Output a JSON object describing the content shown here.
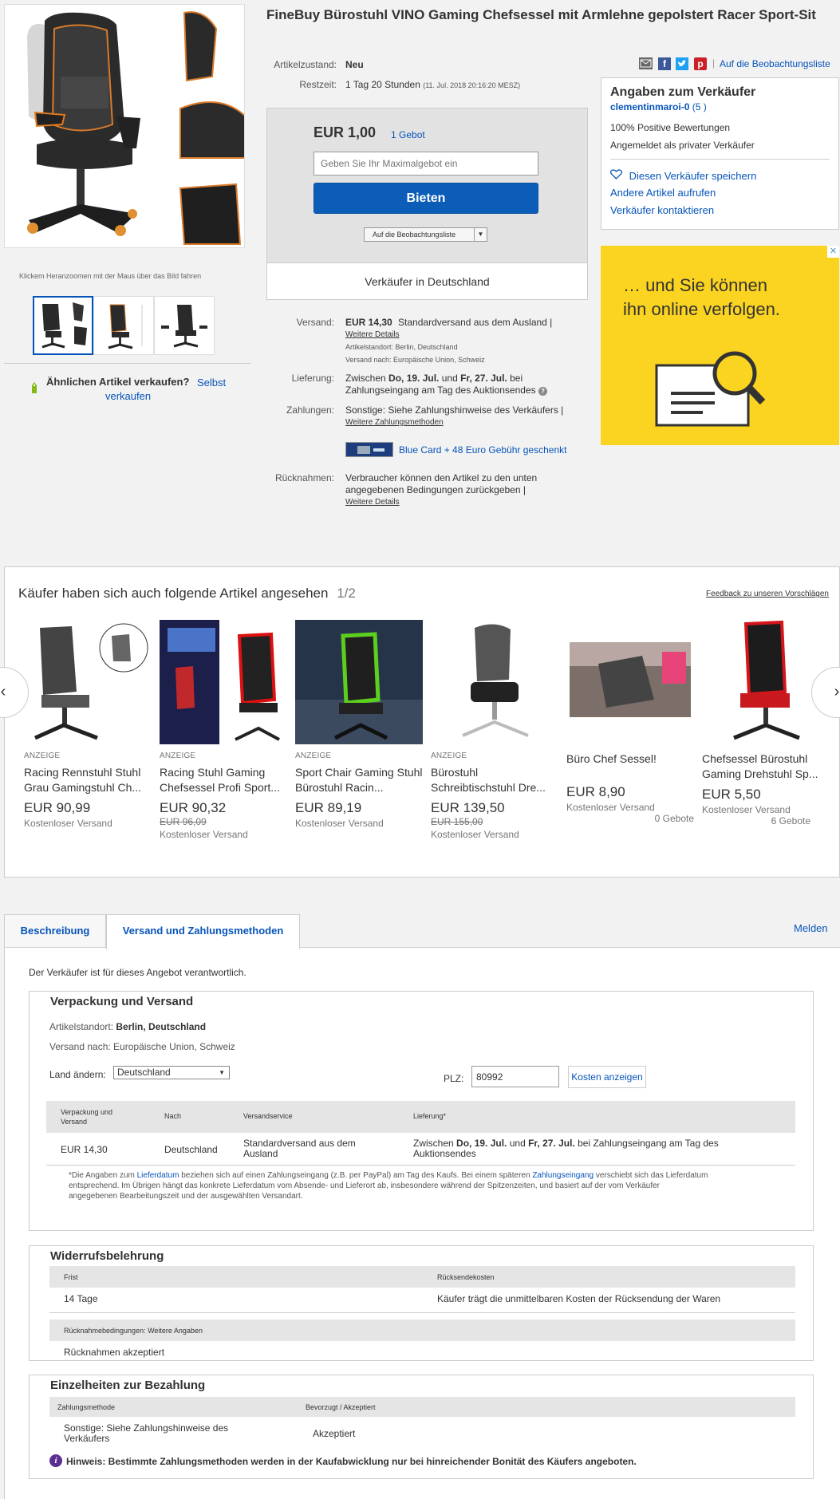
{
  "item": {
    "title": "FineBuy Bürostuhl VINO Gaming Chefsessel mit Armlehne gepolstert Racer Sport-Sit",
    "condition_label": "Artikelzustand:",
    "condition_value": "Neu",
    "time_label": "Restzeit:",
    "time_value": "1 Tag 20 Stunden",
    "time_detail": "(11. Jul. 2018  20:16:20 MESZ)"
  },
  "share": {
    "watch_link": "Auf die Beobachtungsliste"
  },
  "gallery": {
    "zoom_hint": "Klickem Heranzoomen mit der Maus über das Bild fahren"
  },
  "sell_similar": {
    "label": "Ähnlichen Artikel verkaufen?",
    "link": "Selbst verkaufen"
  },
  "buybox": {
    "price": "EUR 1,00",
    "bids": "1 Gebot",
    "placeholder": "Geben Sie Ihr Maximalgebot ein",
    "bid_button": "Bieten",
    "watchlist": "Auf die Beobachtungsliste",
    "seller_location": "Verkäufer in Deutschland"
  },
  "seller": {
    "title": "Angaben zum Verkäufer",
    "name": "clementinmaroi-0",
    "score": "(5 )",
    "positive": "100% Positive Bewertungen",
    "type": "Angemeldet als privater Verkäufer",
    "save": "Diesen Verkäufer speichern",
    "other_items": "Andere Artikel aufrufen",
    "contact": "Verkäufer kontaktieren"
  },
  "ad": {
    "line1": "… und Sie können",
    "line2": "ihn online verfolgen.",
    "close": "✕"
  },
  "shipping": {
    "label": "Versand:",
    "price": "EUR 14,30",
    "service": "Standardversand aus dem Ausland |",
    "details_link": "Weitere Details",
    "location": "Artikelstandort:  Berlin, Deutschland",
    "ship_to": "Versand nach:  Europäische Union, Schweiz"
  },
  "delivery": {
    "label": "Lieferung:",
    "line1_pre": "Zwischen ",
    "d1": "Do, 19. Jul.",
    "mid": " und ",
    "d2": "Fr, 27. Jul.",
    "line1_post": " bei",
    "line2": "Zahlungseingang am Tag des Auktionsendes"
  },
  "payment": {
    "label": "Zahlungen:",
    "text": "Sonstige: Siehe Zahlungshinweise des Verkäufers  |",
    "link": "Weitere Zahlungsmethoden",
    "bluecard": "Blue Card + 48 Euro Gebühr geschenkt"
  },
  "returns": {
    "label": "Rücknahmen:",
    "line1": "Verbraucher können den Artikel zu den unten",
    "line2": "angegebenen Bedingungen zurückgeben |",
    "link": "Weitere Details"
  },
  "carousel": {
    "title": "Käufer haben sich auch folgende Artikel angesehen",
    "page": "1/2",
    "feedback": "Feedback zu unseren Vorschlägen",
    "items": [
      {
        "tag": "ANZEIGE",
        "title": "Racing Rennstuhl Stuhl Grau Gamingstuhl Ch...",
        "price": "EUR 90,99",
        "old": "",
        "ship": "Kostenloser Versand",
        "bids": ""
      },
      {
        "tag": "ANZEIGE",
        "title": "Racing Stuhl Gaming Chefsessel Profi Sport...",
        "price": "EUR 90,32",
        "old": "EUR 96,09",
        "ship": "Kostenloser Versand",
        "bids": ""
      },
      {
        "tag": "ANZEIGE",
        "title": "Sport Chair Gaming Stuhl Bürostuhl Racin...",
        "price": "EUR 89,19",
        "old": "",
        "ship": "Kostenloser Versand",
        "bids": ""
      },
      {
        "tag": "ANZEIGE",
        "title": "Bürostuhl Schreibtischstuhl Dre...",
        "price": "EUR 139,50",
        "old": "EUR 155,00",
        "ship": "Kostenloser Versand",
        "bids": ""
      },
      {
        "tag": "",
        "title": "Büro Chef Sessel!",
        "price": "EUR 8,90",
        "old": "",
        "ship": "Kostenloser Versand",
        "bids": "0 Gebote"
      },
      {
        "tag": "",
        "title": "Chefsessel Bürostuhl Gaming Drehstuhl Sp...",
        "price": "EUR 5,50",
        "old": "",
        "ship": "Kostenloser Versand",
        "bids": "6 Gebote"
      }
    ]
  },
  "tabs": {
    "desc": "Beschreibung",
    "ship": "Versand und Zahlungsmethoden",
    "report": "Melden"
  },
  "details": {
    "responsible": "Der Verkäufer ist für dieses Angebot verantwortlich.",
    "pack_title": "Verpackung und Versand",
    "loc_label": "Artikelstandort: ",
    "loc_value": "Berlin, Deutschland",
    "shipto": "Versand nach: Europäische Union, Schweiz",
    "country_label": "Land ändern:",
    "country": "Deutschland",
    "zip_label": "PLZ:",
    "zip": "80992",
    "cost_btn": "Kosten anzeigen",
    "th_pack": "Verpackung und",
    "th_pack2": "Versand",
    "th_to": "Nach",
    "th_service": "Versandservice",
    "th_delivery": "Lieferung*",
    "r_price": "EUR 14,30",
    "r_to": "Deutschland",
    "r_service1": "Standardversand aus dem",
    "r_service2": "Ausland",
    "r_del_pre": "Zwischen ",
    "r_d1": "Do, 19. Jul.",
    "r_mid": " und ",
    "r_d2": "Fr, 27. Jul.",
    "r_del_post": " bei Zahlungseingang am Tag des",
    "r_del2": "Auktionsendes",
    "note_a": "*Die Angaben zum ",
    "note_l1": "Lieferdatum",
    "note_b": " beziehen sich auf einen Zahlungseingang (z.B. per PayPal) am Tag des Kaufs. Bei einem späteren ",
    "note_l2": "Zahlungseingang",
    "note_c": " verschiebt sich das Lieferdatum",
    "note_2": "entsprechend. Im Übrigen hängt das konkrete Lieferdatum vom Absende- und Lieferort ab, insbesondere während der Spitzenzeiten, und basiert auf der vom Verkäufer",
    "note_3": "angegebenen Bearbeitungszeit und der ausgewählten Versandart.",
    "wr_title": "Widerrufsbelehrung",
    "wr_th1": "Frist",
    "wr_th2": "Rücksendekosten",
    "wr_v1": "14 Tage",
    "wr_v2": "Käufer trägt die unmittelbaren Kosten der Rücksendung der Waren",
    "wr_th3": "Rücknahmebedingungen: Weitere Angaben",
    "wr_v3": "Rücknahmen akzeptiert",
    "pay_title": "Einzelheiten zur Bezahlung",
    "pay_th1": "Zahlungsmethode",
    "pay_th2": "Bevorzugt / Akzeptiert",
    "pay_v1a": "Sonstige: Siehe Zahlungshinweise des",
    "pay_v1b": "Verkäufers",
    "pay_v2": "Akzeptiert",
    "hint": "Hinweis: Bestimmte Zahlungsmethoden werden in der Kaufabwicklung nur bei hinreichender Bonität des Käufers angeboten."
  },
  "colors": {
    "accent": "#0654ba",
    "button": "#0c5db8",
    "ad_bg": "#fbd321"
  }
}
